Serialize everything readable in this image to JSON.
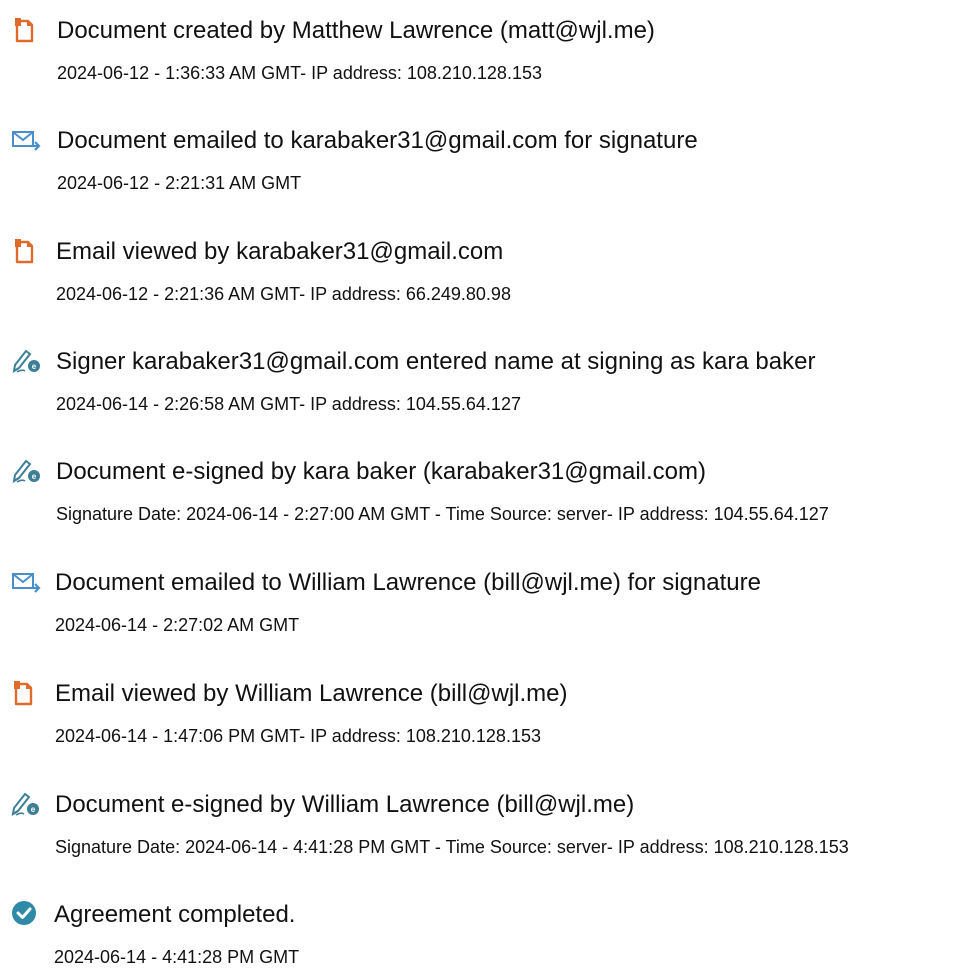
{
  "colors": {
    "doc_icon": "#e06a2c",
    "email_icon": "#4a8fc9",
    "sign_icon": "#3d7f95",
    "check_icon": "#2e8aa6",
    "text": "#111111"
  },
  "events": [
    {
      "icon": "document-icon",
      "title": "Document created by Matthew Lawrence (matt@wjl.me)",
      "detail": "2024-06-12 - 1:36:33 AM GMT- IP address: 108.210.128.153"
    },
    {
      "icon": "email-send-icon",
      "title": "Document emailed to karabaker31@gmail.com for signature",
      "detail": "2024-06-12 - 2:21:31 AM GMT"
    },
    {
      "icon": "document-icon",
      "title": "Email viewed by karabaker31@gmail.com",
      "detail": "2024-06-12 - 2:21:36 AM GMT- IP address: 66.249.80.98"
    },
    {
      "icon": "e-sign-pen-icon",
      "title": "Signer karabaker31@gmail.com entered name at signing as kara baker",
      "detail": "2024-06-14 - 2:26:58 AM GMT- IP address: 104.55.64.127"
    },
    {
      "icon": "e-sign-pen-icon",
      "title": "Document e-signed by kara baker (karabaker31@gmail.com)",
      "detail": "Signature Date: 2024-06-14 - 2:27:00 AM GMT - Time Source: server- IP address: 104.55.64.127"
    },
    {
      "icon": "email-send-icon",
      "title": "Document emailed to William Lawrence (bill@wjl.me) for signature",
      "detail": "2024-06-14 - 2:27:02 AM GMT"
    },
    {
      "icon": "document-icon",
      "title": "Email viewed by William Lawrence (bill@wjl.me)",
      "detail": "2024-06-14 - 1:47:06 PM GMT- IP address: 108.210.128.153"
    },
    {
      "icon": "e-sign-pen-icon",
      "title": "Document e-signed by William Lawrence (bill@wjl.me)",
      "detail": "Signature Date: 2024-06-14 - 4:41:28 PM GMT - Time Source: server- IP address: 108.210.128.153"
    },
    {
      "icon": "checkmark-circle-icon",
      "title": "Agreement completed.",
      "detail": "2024-06-14 - 4:41:28 PM GMT"
    }
  ]
}
